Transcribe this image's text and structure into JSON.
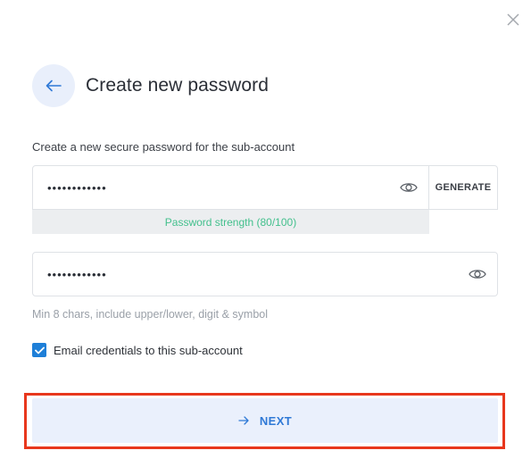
{
  "dialog": {
    "title": "Create new password",
    "intro": "Create a new secure password for the sub-account",
    "password": {
      "value": "••••••••••••",
      "generate_label": "GENERATE",
      "strength_text": "Password strength (80/100)",
      "strength_score": 80
    },
    "confirm": {
      "value": "••••••••••••"
    },
    "hint": "Min 8 chars, include upper/lower, digit & symbol",
    "email_checkbox": {
      "label": "Email credentials to this sub-account",
      "checked": true
    },
    "next_label": "NEXT"
  },
  "icons": {
    "close": "close-icon",
    "back": "arrow-left-icon",
    "eye": "eye-icon",
    "check": "checkmark-icon",
    "next": "arrow-right-icon"
  },
  "colors": {
    "accent": "#2f79d6",
    "checkbox": "#1e7fd8",
    "strength": "#43c08d",
    "highlight": "#e8371d"
  }
}
